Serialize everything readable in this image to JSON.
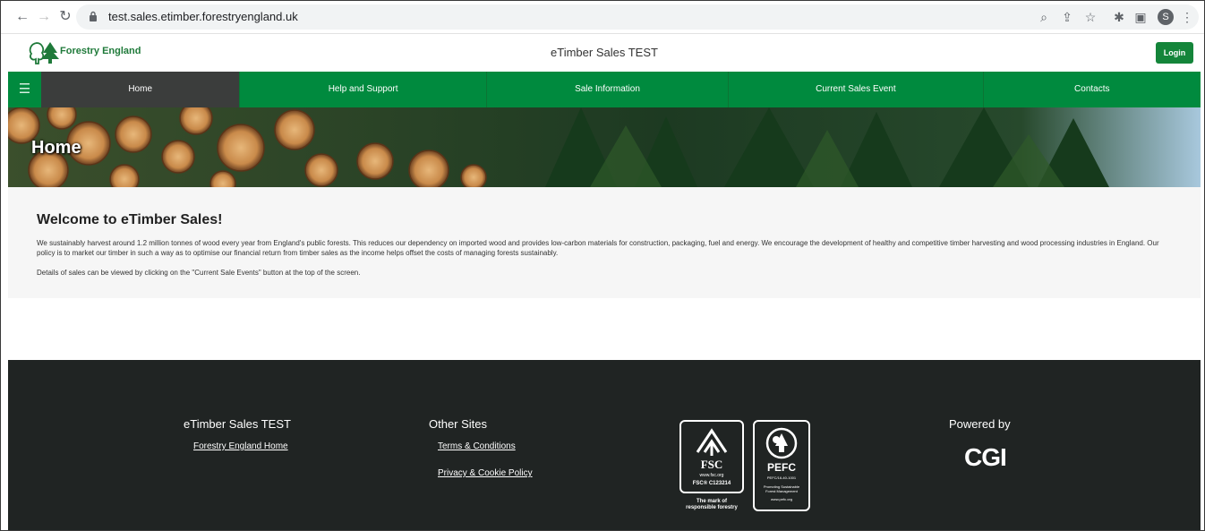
{
  "browser": {
    "url": "test.sales.etimber.forestryengland.uk",
    "profile_initial": "S"
  },
  "header": {
    "logo_text": "Forestry England",
    "title": "eTimber Sales TEST",
    "login_label": "Login"
  },
  "nav": {
    "items": [
      {
        "label": "Home"
      },
      {
        "label": "Help and Support"
      },
      {
        "label": "Sale Information"
      },
      {
        "label": "Current Sales Event"
      },
      {
        "label": "Contacts"
      }
    ]
  },
  "banner": {
    "heading": "Home"
  },
  "content": {
    "title": "Welcome to eTimber Sales!",
    "paragraph1": "We sustainably harvest around 1.2 million tonnes of wood every year from England's public forests. This reduces our dependency on imported wood and provides low-carbon materials for construction, packaging, fuel and energy. We encourage the development of healthy and competitive timber harvesting and wood processing industries in England. Our policy is to market our timber in such a way as to optimise our financial return from timber sales as the income helps offset the costs of managing forests sustainably.",
    "paragraph2": "Details of sales can be viewed by clicking on the \"Current Sale Events\" button at the top of the screen."
  },
  "footer": {
    "col1_heading": "eTimber Sales TEST",
    "col1_link": "Forestry England Home",
    "col2_heading": "Other Sites",
    "col2_links": [
      "Terms & Conditions",
      "Privacy & Cookie Policy"
    ],
    "fsc": {
      "name": "FSC",
      "site": "www.fsc.org",
      "code": "FSC® C123214",
      "tagline_1": "The mark of",
      "tagline_2": "responsible forestry"
    },
    "pefc": {
      "name": "PEFC",
      "code": "PEFC/16-40-1001",
      "tagline_1": "Promoting Sustainable",
      "tagline_2": "Forest Management",
      "site": "www.pefc.org"
    },
    "powered_by": "Powered by",
    "powered_logo": "CGI"
  }
}
